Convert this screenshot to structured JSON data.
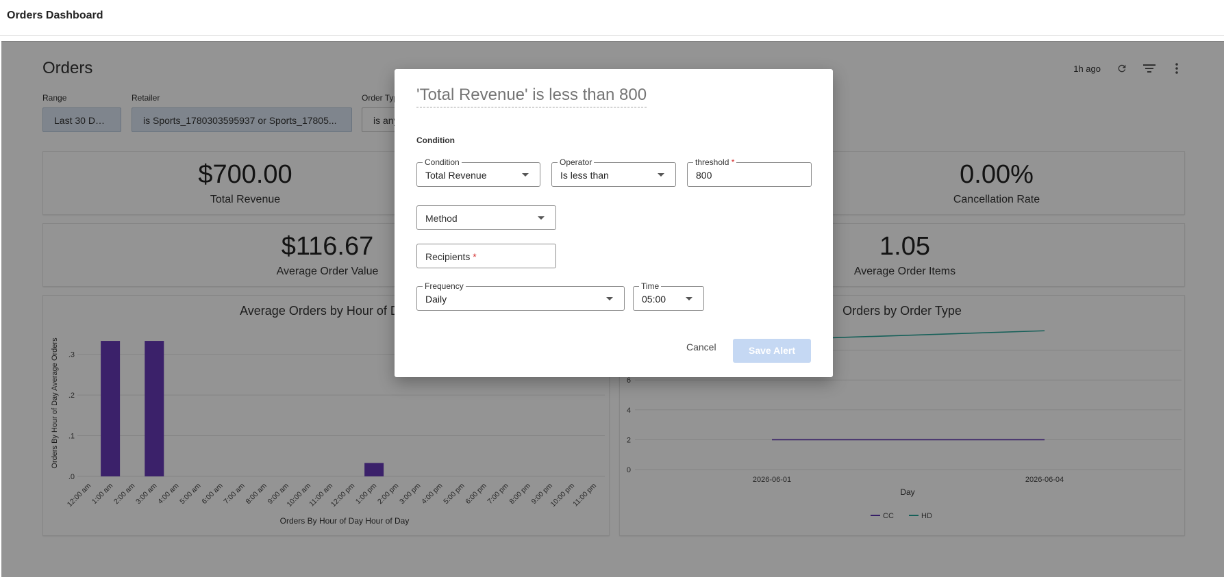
{
  "app": {
    "title": "Orders Dashboard"
  },
  "page": {
    "title": "Orders",
    "updated": "1h ago",
    "filters": [
      {
        "label": "Range",
        "value": "Last 30 Days"
      },
      {
        "label": "Retailer",
        "value": "is Sports_1780303595937 or Sports_17805..."
      },
      {
        "label": "Order Type",
        "value": "is any value"
      }
    ],
    "kpis": [
      {
        "value": "$700.00",
        "label": "Total Revenue"
      },
      {
        "value": "0.00%",
        "label": "Cancellation Rate"
      },
      {
        "value": "$116.67",
        "label": "Average Order Value"
      },
      {
        "value": "1.05",
        "label": "Average Order Items"
      }
    ]
  },
  "chart_data": [
    {
      "type": "bar",
      "title": "Average Orders by Hour of Day",
      "xlabel": "Orders By Hour of Day Hour of Day",
      "ylabel": "Orders By Hour of Day Average Orders",
      "categories": [
        "12:00 am",
        "1:00 am",
        "2:00 am",
        "3:00 am",
        "4:00 am",
        "5:00 am",
        "6:00 am",
        "7:00 am",
        "8:00 am",
        "9:00 am",
        "10:00 am",
        "11:00 am",
        "12:00 pm",
        "1:00 pm",
        "2:00 pm",
        "3:00 pm",
        "4:00 pm",
        "5:00 pm",
        "6:00 pm",
        "7:00 pm",
        "8:00 pm",
        "9:00 pm",
        "10:00 pm",
        "11:00 pm"
      ],
      "values": [
        0,
        0.333,
        0,
        0.333,
        0,
        0,
        0,
        0,
        0,
        0,
        0,
        0,
        0,
        0.033,
        0,
        0,
        0,
        0,
        0,
        0,
        0,
        0,
        0,
        0
      ],
      "yticks": [
        ".0",
        ".1",
        ".2",
        ".3"
      ],
      "ylim": [
        0,
        0.36
      ],
      "color": "#673ab7"
    },
    {
      "type": "line",
      "title": "Orders by Order Type",
      "xlabel": "Day",
      "x": [
        "2026-06-01",
        "2026-06-04"
      ],
      "yticks": [
        "0",
        "2",
        "4",
        "6"
      ],
      "series": [
        {
          "name": "CC",
          "values": [
            2,
            2
          ],
          "color": "#5e35b1"
        },
        {
          "name": "HD",
          "values": [
            8.7,
            9.3
          ],
          "color": "#26a69a"
        }
      ],
      "ylim": [
        0,
        10
      ],
      "legend": "bottom"
    }
  ],
  "modal": {
    "title": "'Total Revenue' is less than 800",
    "section_label": "Condition",
    "condition": {
      "label": "Condition",
      "value": "Total Revenue"
    },
    "operator": {
      "label": "Operator",
      "value": "Is less than"
    },
    "threshold": {
      "label": "threshold",
      "value": "800",
      "required": "*"
    },
    "method": {
      "placeholder": "Method"
    },
    "recipients": {
      "placeholder": "Recipients",
      "required": "*"
    },
    "frequency": {
      "label": "Frequency",
      "value": "Daily"
    },
    "time": {
      "label": "Time",
      "value": "05:00"
    },
    "cancel_label": "Cancel",
    "save_label": "Save Alert"
  }
}
